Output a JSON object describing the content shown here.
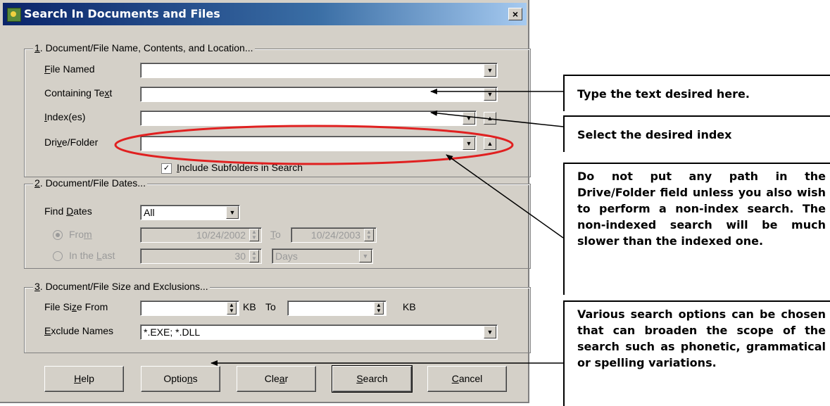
{
  "window": {
    "title": "Search In Documents and Files",
    "close_glyph": "×"
  },
  "group1": {
    "legend_prefix": "1",
    "legend_rest": ". Document/File Name, Contents, and Location...",
    "file_named": {
      "label_u": "F",
      "label_rest": "ile Named",
      "value": ""
    },
    "containing_text": {
      "label_a": "Containing Te",
      "label_u": "x",
      "label_b": "t",
      "value": ""
    },
    "indexes": {
      "label_u": "I",
      "label_rest": "ndex(es)",
      "value": ""
    },
    "drive_folder": {
      "label_a": "Dri",
      "label_u": "v",
      "label_b": "e/Folder",
      "value": ""
    },
    "subfolders": {
      "checked": "✓",
      "label_u": "I",
      "label_rest": "nclude Subfolders in Search"
    }
  },
  "group2": {
    "legend_prefix": "2",
    "legend_rest": ". Document/File Dates...",
    "find_dates": {
      "label_a": "Find ",
      "label_u": "D",
      "label_b": "ates",
      "value": "All"
    },
    "from": {
      "label_a": "Fro",
      "label_u": "m",
      "from_value": "10/24/2002",
      "to_u": "T",
      "to_rest": "o",
      "to_value": "10/24/2003"
    },
    "in_the_last": {
      "label_a": "In the ",
      "label_u": "L",
      "label_b": "ast",
      "number": "30",
      "unit": "Days"
    }
  },
  "group3": {
    "legend_prefix": "3",
    "legend_rest": ". Document/File Size and Exclusions...",
    "file_size": {
      "label_a": "File Si",
      "label_u": "z",
      "label_b": "e From",
      "from_value": "",
      "kb1": "KB",
      "to": "To",
      "to_value": "",
      "kb2": "KB"
    },
    "exclude": {
      "label_u": "E",
      "label_rest": "xclude Names",
      "value": "*.EXE; *.DLL"
    }
  },
  "buttons": {
    "help": {
      "u": "H",
      "rest": "elp"
    },
    "options": {
      "a": "Optio",
      "u": "n",
      "b": "s"
    },
    "clear": {
      "a": "Cle",
      "u": "a",
      "b": "r"
    },
    "search": {
      "u": "S",
      "rest": "earch"
    },
    "cancel": {
      "u": "C",
      "rest": "ancel"
    }
  },
  "annotations": {
    "type_text": "Type the text desired here.",
    "select_index": "Select the desired index",
    "drive_note": "Do not put any path in the Drive/Folder field unless you also wish to perform a non-index search. The non-indexed search will be much slower than the indexed one.",
    "options_note": "Various search options can be chosen that can broaden the scope of the search such as phonetic, grammatical or spelling variations."
  },
  "colors": {
    "highlight_ellipse": "#e02020",
    "dialog_bg": "#d4d0c8",
    "titlebar": "#0a246a"
  }
}
